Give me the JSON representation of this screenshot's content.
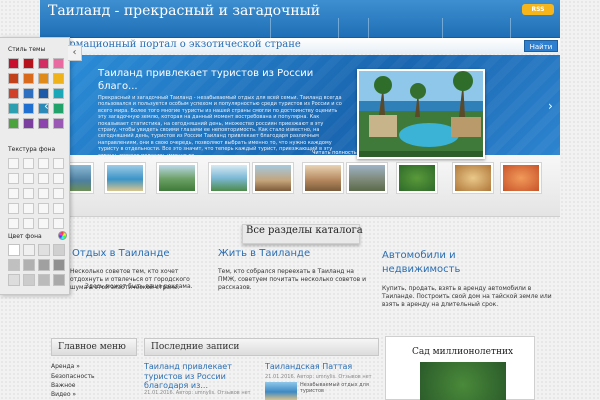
{
  "header": {
    "title": "Таиланд - прекрасный и загадочный",
    "rss_label": "RSS",
    "subtitle": "Информационный портал о экзотической стране",
    "search_label": "Найти"
  },
  "slider": {
    "title": "Таиланд привлекает туристов из России благо...",
    "text": "Прекрасный и загадочный Таиланд - незабываемый отдых для всей семьи. Таиланд всегда пользовался и пользуется особым успехом и популярностью среди туристов из России и со всего мира. Более того многие туристы из нашей страны смогли по достоинству оценить эту загадочную землю, которая на данный момент востребована и популярна. Как показывает статистика, на сегодняшний день, множество россиян приезжают в эту страну, чтобы увидеть своими глазами ее неповторимость. Как стало известно, на сегодняшний день, туристов из России Таиланд привлекает благодаря различным направлениям, они в свою очередь, позволяют выбрать именно то, что нужно каждому туристу в отдельности. Все это значит, что теперь каждый турист, приезжающий в эту страну, сможет получить именно то...",
    "more_label": "Читать полностью »",
    "prev_arrow": "‹",
    "next_arrow": "›"
  },
  "all_sections_label": "Все разделы каталога",
  "features": [
    {
      "title": "Отдых в Таиланде",
      "text": "Несколько советов тем, кто хочет отдохнуть и отвлечься от городского шума в этой экзотической стране."
    },
    {
      "title": "Жить в Таиланде",
      "text": "Тем, кто собрался переехать в Таиланд на ПМЖ, советуем почитать несколько советов и рассказов."
    },
    {
      "title": "Автомобили и недвижимость",
      "text": "Купить, продать, взять в аренду автомобили в Таиланде. Построить свой дом на тайской земле или взять в аренду на длительный срок."
    }
  ],
  "ad_text": "Здесь может быть ваша реклама.",
  "main_menu": {
    "title": "Главное меню",
    "items": [
      "Аренда »",
      "Безопасность",
      "Важное",
      "Видео »"
    ]
  },
  "recent_posts": {
    "title": "Последние записи",
    "posts": [
      {
        "title": "Таиланд привлекает туристов из России благодаря из...",
        "meta": "21.01.2016. Автор: umnylis. Отзывов нет"
      },
      {
        "title": "Таиландская Паттая",
        "meta": "21.01.2016. Автор: umnylis. Отзывов нет",
        "snippet": "Незабываемый отдых для туристов"
      }
    ]
  },
  "side_widget": {
    "title": "Сад миллионолетних"
  },
  "theme_panel": {
    "style_label": "Стиль темы",
    "texture_label": "Текстура фона",
    "bg_color_label": "Цвет фона",
    "toggle_icon": "‹",
    "swatches": [
      "#c8102e",
      "#b5121b",
      "#d22e63",
      "#e86aa0",
      "#c2411b",
      "#d96a1c",
      "#e08a1a",
      "#f0b21b",
      "#d0402a",
      "#2f6fbf",
      "#1f5aa8",
      "#1aa7b8",
      "#2c9fb0",
      "#1f6fd0",
      "#2b8ab8",
      "#20a26a",
      "#4aa33d",
      "#7b3fa0",
      "#8e44ad",
      "#9b59b6"
    ],
    "grays": [
      "#ffffff",
      "#f0f0f0",
      "#e0e0e0",
      "#d0d0d0",
      "#c0c0c0",
      "#b0b0b0",
      "#a0a0a0",
      "#909090",
      "#dddddd",
      "#cccccc",
      "#bbbbbb",
      "#aaaaaa"
    ]
  },
  "colors": {
    "header_blue": "#1f6fb6",
    "link_blue": "#2a6eb3",
    "rss_orange": "#f5b51b"
  }
}
